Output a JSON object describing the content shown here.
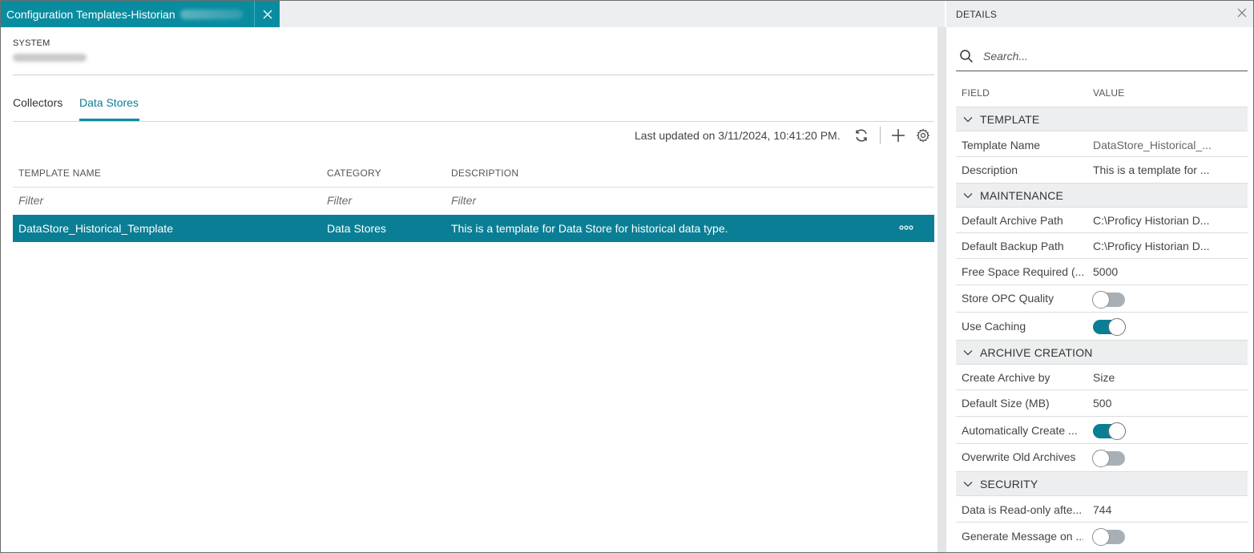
{
  "document_tab": {
    "title": "Configuration Templates-Historian"
  },
  "system": {
    "label": "SYSTEM"
  },
  "tabs": [
    {
      "label": "Collectors",
      "active": false
    },
    {
      "label": "Data Stores",
      "active": true
    }
  ],
  "toolbar": {
    "last_updated": "Last updated on 3/11/2024, 10:41:20 PM.",
    "icons": [
      "refresh-icon",
      "add-icon",
      "settings-icon"
    ]
  },
  "table": {
    "headers": [
      "TEMPLATE NAME",
      "CATEGORY",
      "DESCRIPTION"
    ],
    "filter_placeholder": "Filter",
    "rows": [
      {
        "template_name": "DataStore_Historical_Template",
        "category": "Data Stores",
        "description": "This is a template for Data Store for historical data type.",
        "selected": true
      }
    ]
  },
  "details": {
    "title": "DETAILS",
    "search_placeholder": "Search...",
    "field_header": "FIELD",
    "value_header": "VALUE",
    "sections": [
      {
        "name": "TEMPLATE",
        "fields": [
          {
            "label": "Template Name",
            "value": "DataStore_Historical_..."
          },
          {
            "label": "Description",
            "value": "This is a template for ..."
          }
        ]
      },
      {
        "name": "MAINTENANCE",
        "fields": [
          {
            "label": "Default Archive Path",
            "value": "C:\\Proficy Historian D..."
          },
          {
            "label": "Default Backup Path",
            "value": "C:\\Proficy Historian D..."
          },
          {
            "label": "Free Space Required (...",
            "value": "5000"
          },
          {
            "label": "Store OPC Quality",
            "toggle": false
          },
          {
            "label": "Use Caching",
            "toggle": true
          }
        ]
      },
      {
        "name": "ARCHIVE CREATION",
        "fields": [
          {
            "label": "Create Archive by",
            "value": "Size"
          },
          {
            "label": "Default Size (MB)",
            "value": "500"
          },
          {
            "label": "Automatically Create ...",
            "toggle": true
          },
          {
            "label": "Overwrite Old Archives",
            "toggle": false
          }
        ]
      },
      {
        "name": "SECURITY",
        "fields": [
          {
            "label": "Data is Read-only afte...",
            "value": "744"
          },
          {
            "label": "Generate Message on ...",
            "toggle": false
          }
        ]
      }
    ]
  },
  "colors": {
    "accent": "#0a8ca0",
    "selected_row": "#0a7e95",
    "panel_header": "#eceef0",
    "toggle_off": "#a9b0b5"
  }
}
